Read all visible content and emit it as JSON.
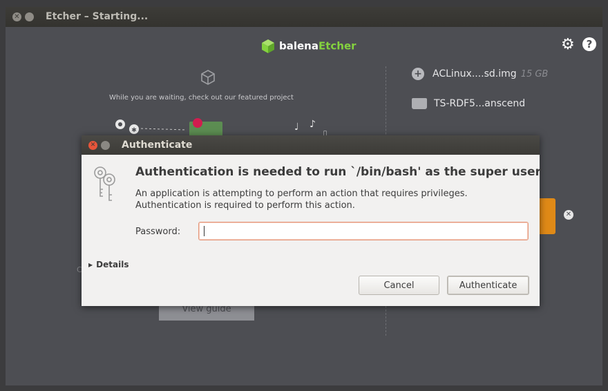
{
  "etcher": {
    "window_title": "Etcher – Starting...",
    "logo_prefix": "balena",
    "logo_suffix": "Etcher",
    "waiting_text": "While you are waiting, check out our featured project",
    "image_name": "ACLinux....sd.img",
    "image_size": "15 GB",
    "drive_name": "TS-RDF5...anscend",
    "view_guide_label": "View guide",
    "stray_text": "C",
    "colors": {
      "background": "#4d4e53",
      "accent_green": "#84d23f",
      "flash_orange": "#e08a17"
    }
  },
  "dialog": {
    "title": "Authenticate",
    "heading": "Authentication is needed to run `/bin/bash' as the super user",
    "message_line1": "An application is attempting to perform an action that requires privileges.",
    "message_line2": "Authentication is required to perform this action.",
    "password_label": "Password:",
    "password_value": "",
    "details_label": "Details",
    "cancel_label": "Cancel",
    "authenticate_label": "Authenticate"
  }
}
